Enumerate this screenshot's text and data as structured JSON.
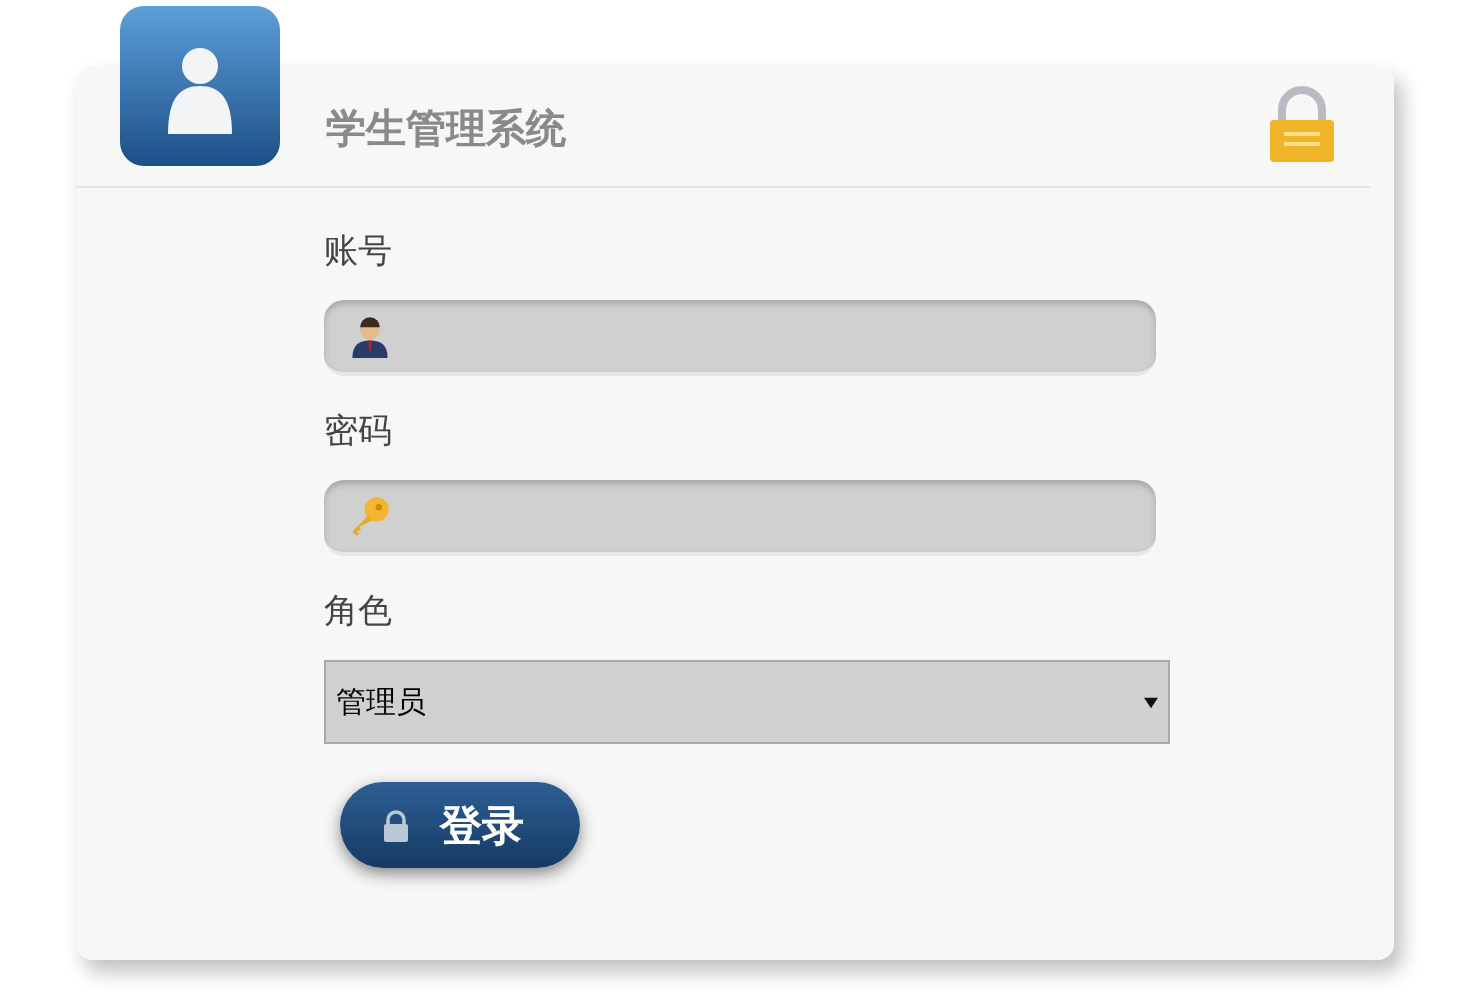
{
  "title": "学生管理系统",
  "fields": [
    {
      "label": "账号",
      "kind": "user"
    },
    {
      "label": "密码",
      "kind": "password"
    }
  ],
  "role": {
    "label": "角色",
    "value": "管理员"
  },
  "login_button": "登录"
}
